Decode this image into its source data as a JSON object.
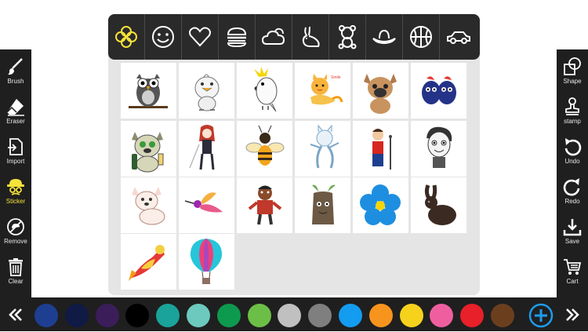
{
  "left_toolbar": [
    {
      "label": "Brush",
      "icon": "brush-icon",
      "active": false
    },
    {
      "label": "Eraser",
      "icon": "eraser-icon",
      "active": false
    },
    {
      "label": "Import",
      "icon": "import-icon",
      "active": false
    },
    {
      "label": "Sticker",
      "icon": "sticker-icon",
      "active": true
    },
    {
      "label": "Remove",
      "icon": "remove-icon",
      "active": false
    },
    {
      "label": "Clear",
      "icon": "trash-icon",
      "active": false
    }
  ],
  "right_toolbar": [
    {
      "label": "Shape",
      "icon": "shape-icon"
    },
    {
      "label": "stamp",
      "icon": "stamp-icon"
    },
    {
      "label": "Undo",
      "icon": "undo-icon"
    },
    {
      "label": "Redo",
      "icon": "redo-icon"
    },
    {
      "label": "Save",
      "icon": "save-icon"
    },
    {
      "label": "Cart",
      "icon": "cart-icon"
    }
  ],
  "sticker_categories": [
    {
      "icon": "flower-icon",
      "selected": true
    },
    {
      "icon": "smiley-icon",
      "selected": false
    },
    {
      "icon": "heart-icon",
      "selected": false
    },
    {
      "icon": "burger-icon",
      "selected": false
    },
    {
      "icon": "cloud-sun-icon",
      "selected": false
    },
    {
      "icon": "rabbit-icon",
      "selected": false
    },
    {
      "icon": "teddy-bear-icon",
      "selected": false
    },
    {
      "icon": "hat-icon",
      "selected": false
    },
    {
      "icon": "basketball-icon",
      "selected": false
    },
    {
      "icon": "car-icon",
      "selected": false
    }
  ],
  "stickers": [
    {
      "icon": "owl-sticker"
    },
    {
      "icon": "baby-bird-sticker"
    },
    {
      "icon": "cockatoo-sticker"
    },
    {
      "icon": "cat-smile-sticker",
      "text": "Smile"
    },
    {
      "icon": "french-bulldog-sticker"
    },
    {
      "icon": "blueberries-sticker"
    },
    {
      "icon": "bulldog-champagne-sticker"
    },
    {
      "icon": "anime-girl-sticker"
    },
    {
      "icon": "bee-sticker"
    },
    {
      "icon": "dancing-cat-sticker"
    },
    {
      "icon": "rock-singer-sticker"
    },
    {
      "icon": "cartoon-boy-sticker"
    },
    {
      "icon": "puppy-sticker"
    },
    {
      "icon": "hummingbird-sticker"
    },
    {
      "icon": "cartoon-man-sticker"
    },
    {
      "icon": "tree-stump-sticker"
    },
    {
      "icon": "blue-flower-sticker"
    },
    {
      "icon": "black-rabbit-sticker"
    },
    {
      "icon": "flying-hero-sticker"
    },
    {
      "icon": "hot-air-balloon-sticker"
    }
  ],
  "palette": [
    "#1e3f91",
    "#0f1a45",
    "#3b1d5a",
    "#000000",
    "#1aa39a",
    "#6cc9bd",
    "#0e9a4e",
    "#6cbf46",
    "#c0c0c0",
    "#7f7f7f",
    "#139cf0",
    "#f7941d",
    "#f6d21d",
    "#ef5fa0",
    "#e8202a",
    "#6b3f1e"
  ],
  "nav": {
    "left": "double-chevron-left-icon",
    "right": "double-chevron-right-icon",
    "add": "add-color-icon"
  },
  "colors": {
    "accent": "#f5e33a",
    "toolbar": "#1f1f1f",
    "add_button": "#1c9cf0"
  }
}
